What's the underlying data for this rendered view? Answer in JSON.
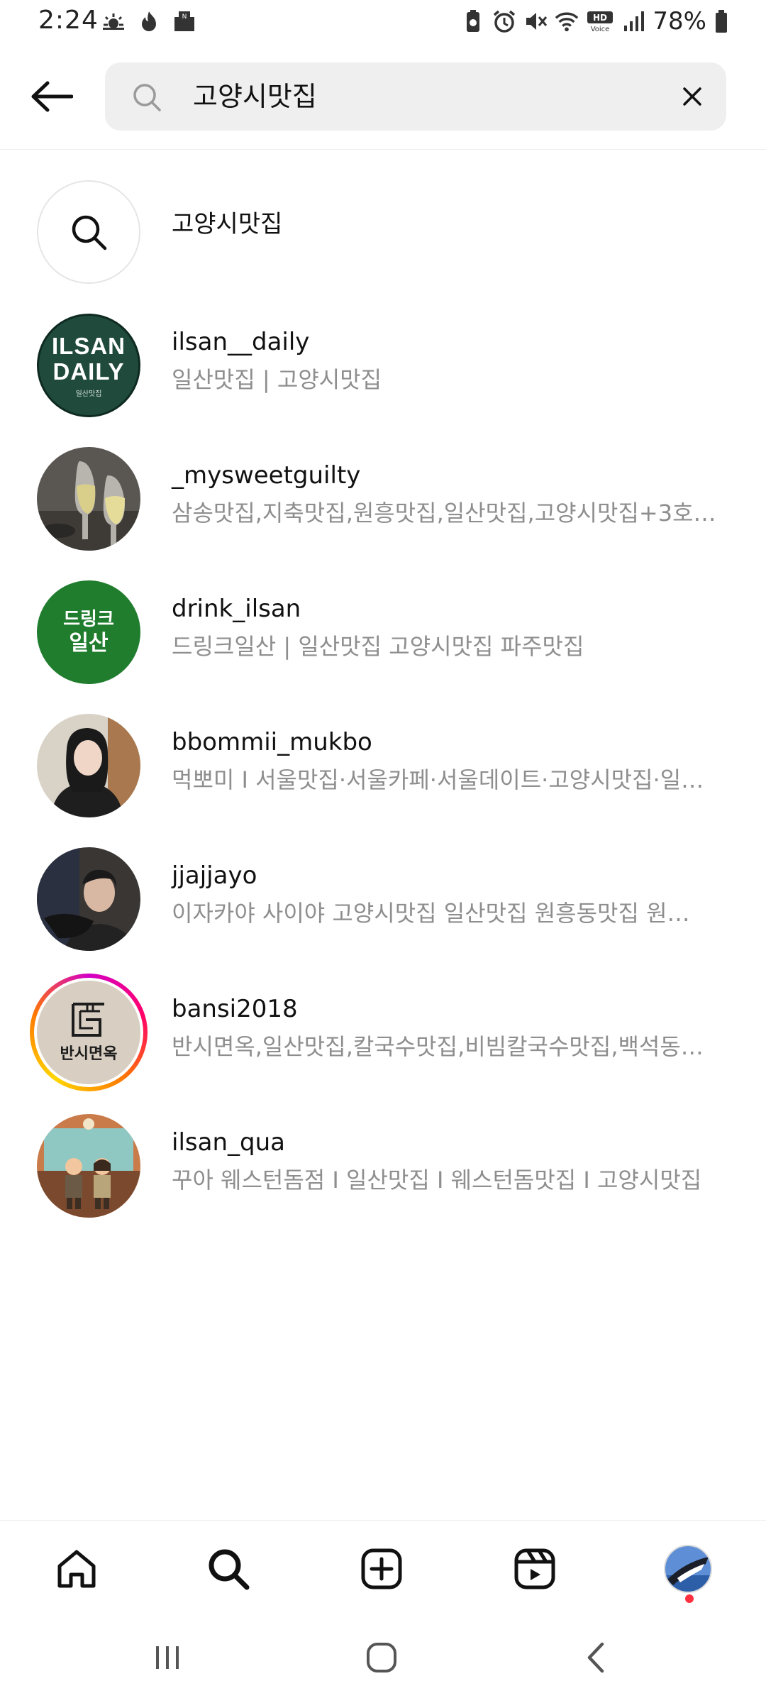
{
  "status_bar": {
    "time": "2:24",
    "battery": "78%",
    "left_icons": [
      "weather-icon",
      "fire-icon",
      "mail-icon"
    ],
    "right_icons": [
      "battery-saver-icon",
      "alarm-icon",
      "mute-icon",
      "wifi-icon",
      "hd-voice-icon",
      "signal-icon",
      "battery-icon"
    ]
  },
  "search": {
    "query": "고양시맛집"
  },
  "results": [
    {
      "type": "query",
      "username": "고양시맛집",
      "subtitle": ""
    },
    {
      "type": "account",
      "username": "ilsan__daily",
      "subtitle": "일산맛집 | 고양시맛집",
      "avatar_text": [
        "ILSAN",
        "DAILY",
        "일산맛집"
      ]
    },
    {
      "type": "account",
      "username": "_mysweetguilty",
      "subtitle": "삼송맛집,지축맛집,원흥맛집,일산맛집,고양시맛집+3호…"
    },
    {
      "type": "account",
      "username": "drink_ilsan",
      "subtitle": "드링크일산 | 일산맛집 고양시맛집 파주맛집",
      "avatar_text": [
        "드링크",
        "일산"
      ]
    },
    {
      "type": "account",
      "username": "bbommii_mukbo",
      "subtitle": "먹뽀미 I 서울맛집·서울카페·서울데이트·고양시맛집·일…"
    },
    {
      "type": "account",
      "username": "jjajjayo",
      "subtitle": "이자카야 사이야 고양시맛집 일산맛집 원흥동맛집 원…"
    },
    {
      "type": "account",
      "username": "bansi2018",
      "subtitle": "반시면옥,일산맛집,칼국수맛집,비빔칼국수맛집,백석동…",
      "avatar_text": [
        "반시면옥"
      ]
    },
    {
      "type": "account",
      "username": "ilsan_qua",
      "subtitle": "꾸아 웨스턴돔점 I 일산맛집 I 웨스턴돔맛집 I 고양시맛집"
    }
  ],
  "bottom_nav": [
    "home-icon",
    "search-icon",
    "create-icon",
    "reels-icon",
    "profile-avatar"
  ],
  "colors": {
    "subtitle": "#8e8e8e",
    "search_bg": "#efefef",
    "notification_dot": "#ff3040"
  }
}
